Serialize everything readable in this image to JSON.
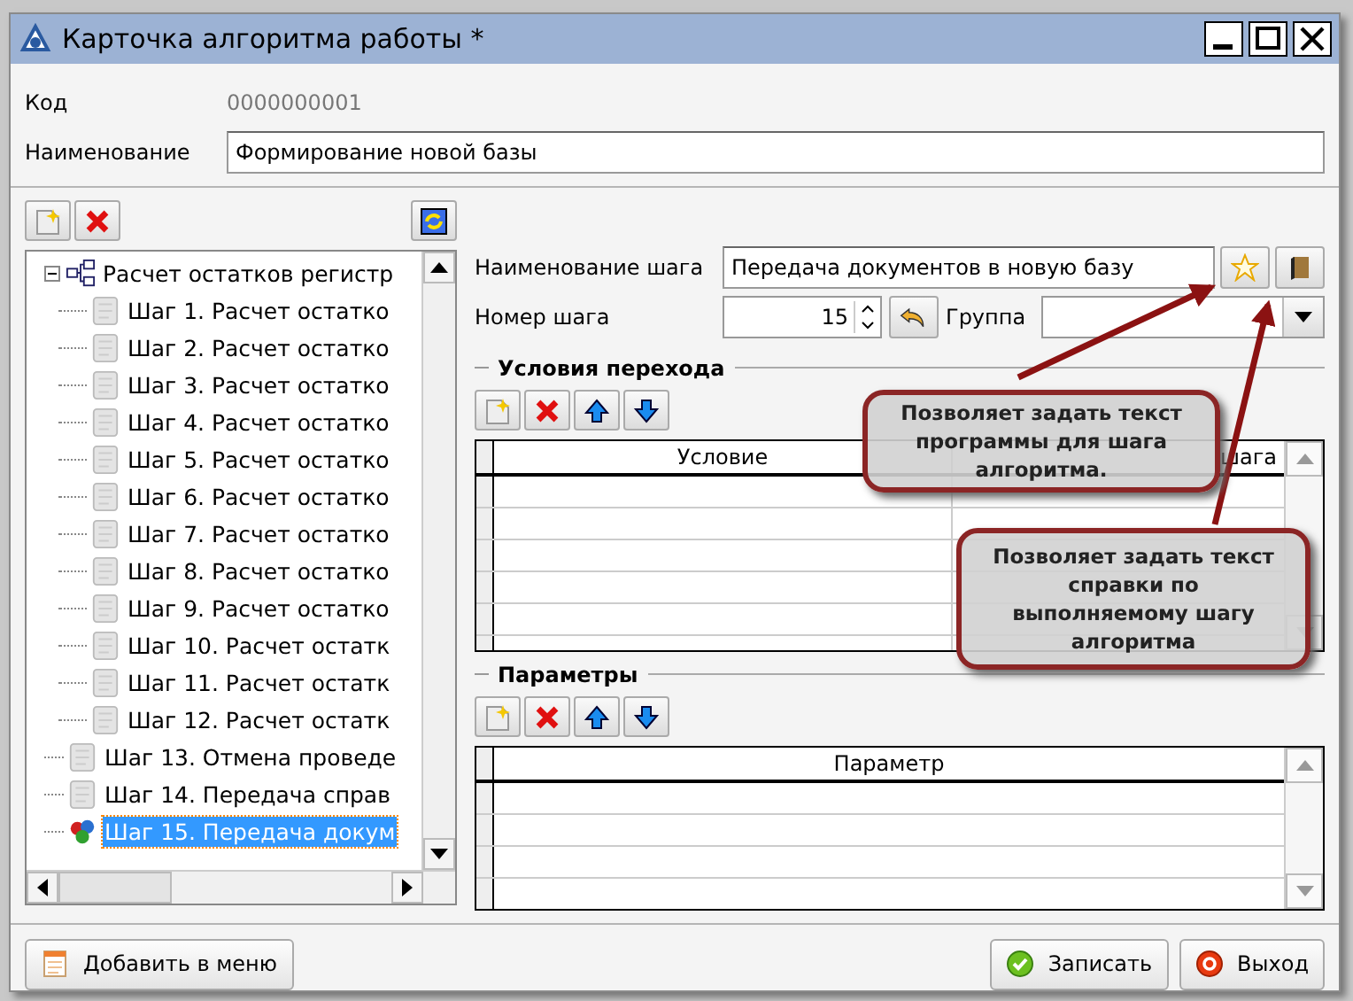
{
  "window": {
    "title": "Карточка алгоритма работы *"
  },
  "code": {
    "label": "Код",
    "value": "0000000001"
  },
  "name": {
    "label": "Наименование",
    "value": "Формирование новой базы"
  },
  "tree": [
    {
      "kind": "group",
      "label": "Расчет остатков регистр",
      "expanded": true,
      "selected": false,
      "children": [
        {
          "kind": "step",
          "label": "Шаг 1. Расчет остатко",
          "selected": false
        },
        {
          "kind": "step",
          "label": "Шаг 2. Расчет остатко",
          "selected": false
        },
        {
          "kind": "step",
          "label": "Шаг 3. Расчет остатко",
          "selected": false
        },
        {
          "kind": "step",
          "label": "Шаг 4. Расчет остатко",
          "selected": false
        },
        {
          "kind": "step",
          "label": "Шаг 5. Расчет остатко",
          "selected": false
        },
        {
          "kind": "step",
          "label": "Шаг 6. Расчет остатко",
          "selected": false
        },
        {
          "kind": "step",
          "label": "Шаг 7. Расчет остатко",
          "selected": false
        },
        {
          "kind": "step",
          "label": "Шаг 8. Расчет остатко",
          "selected": false
        },
        {
          "kind": "step",
          "label": "Шаг 9. Расчет остатко",
          "selected": false
        },
        {
          "kind": "step",
          "label": "Шаг 10. Расчет остатк",
          "selected": false
        },
        {
          "kind": "step",
          "label": "Шаг 11. Расчет остатк",
          "selected": false
        },
        {
          "kind": "step",
          "label": "Шаг 12. Расчет остатк",
          "selected": false
        }
      ]
    },
    {
      "kind": "step",
      "label": "Шаг 13. Отмена проведе",
      "selected": false
    },
    {
      "kind": "step",
      "label": "Шаг 14. Передача справ",
      "selected": false
    },
    {
      "kind": "active_step",
      "label": "Шаг 15. Передача докум",
      "selected": true
    }
  ],
  "step": {
    "name_label": "Наименование шага",
    "name_value": "Передача документов в новую базу",
    "number_label": "Номер шага",
    "number_value": "15",
    "group_label": "Группа"
  },
  "conditions": {
    "title": "Условия перехода",
    "columns": [
      "Условие",
      "шага"
    ]
  },
  "parameters": {
    "title": "Параметры",
    "columns": [
      "Параметр"
    ]
  },
  "callouts": [
    {
      "text": "Позволяет задать текст программы для шага алгоритма."
    },
    {
      "text": "Позволяет задать текст справки по выполняемому шагу алгоритма"
    }
  ],
  "buttons": {
    "add_menu": "Добавить в меню",
    "save": "Записать",
    "exit": "Выход"
  }
}
